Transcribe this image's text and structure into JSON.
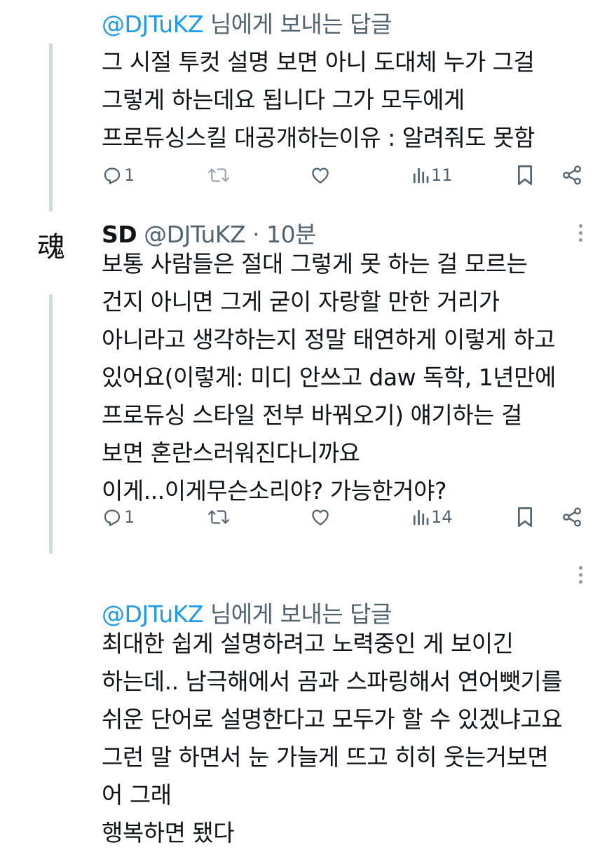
{
  "tweets": [
    {
      "reply_prefix": "@DJTuKZ",
      "reply_suffix": " 님에게 보내는 답글",
      "text": "그 시절 투컷 설명 보면 아니 도대체 누가 그걸\n그렇게 하는데요 됩니다 그가 모두에게\n프로듀싱스킬 대공개하는이유 : 알려줘도 못함",
      "replies": "1",
      "reposts": "",
      "likes": "",
      "views": "11"
    },
    {
      "author": "SD",
      "handle": "@DJTuKZ",
      "separator": " · ",
      "time": "10분",
      "text": "보통 사람들은 절대 그렇게 못 하는 걸 모르는\n건지 아니면 그게 굳이 자랑할 만한 거리가\n아니라고 생각하는지 정말 태연하게 이렇게 하고\n있어요(이렇게: 미디 안쓰고 daw 독학, 1년만에\n프로듀싱 스타일 전부 바꿔오기) 얘기하는 걸\n보면 혼란스러워진다니까요\n이게...이게무슨소리야? 가능한거야?",
      "replies": "1",
      "reposts": "",
      "likes": "",
      "views": "14"
    },
    {
      "reply_prefix": "@DJTuKZ",
      "reply_suffix": " 님에게 보내는 답글",
      "text": "최대한 쉽게 설명하려고 노력중인 게 보이긴\n하는데.. 남극해에서 곰과 스파링해서 연어뺏기를\n쉬운 단어로 설명한다고 모두가 할 수 있겠냐고요\n그런 말 하면서 눈 가늘게 뜨고 히히 웃는거보면\n어 그래\n행복하면 됐다"
    }
  ],
  "avatar_glyph": "魂",
  "icons": {
    "reply": "reply-icon",
    "repost": "repost-icon",
    "like": "heart-icon",
    "views": "views-icon",
    "bookmark": "bookmark-icon",
    "share": "share-icon",
    "more": "more-options-icon"
  },
  "colors": {
    "text": "#0f1419",
    "secondary": "#536471",
    "link": "#1d9bf0",
    "thread_line": "#cfd9de"
  }
}
